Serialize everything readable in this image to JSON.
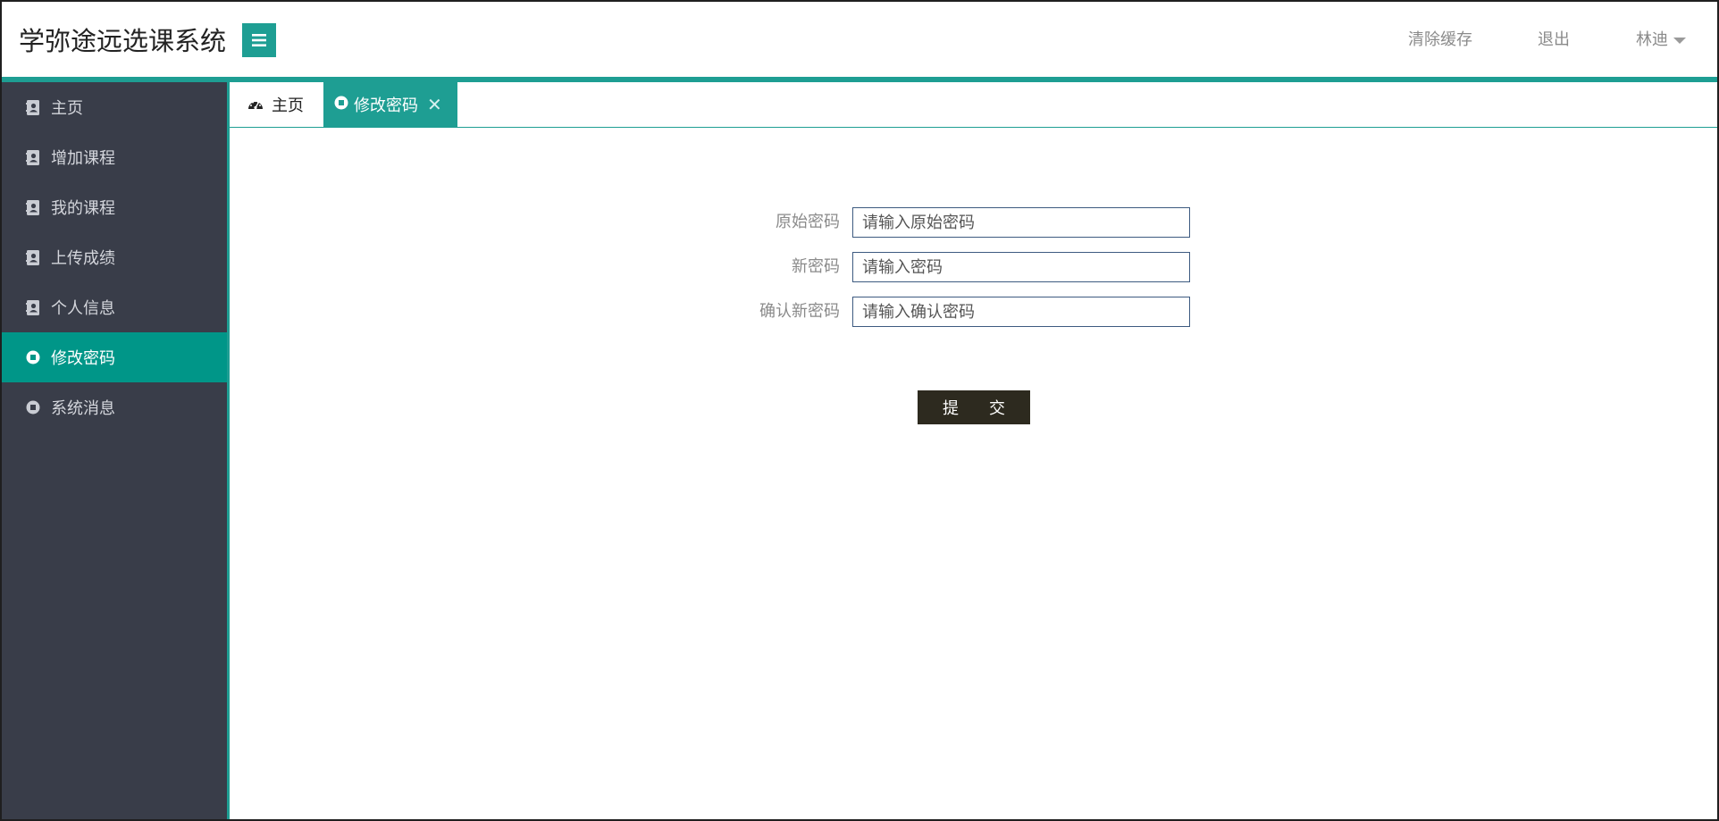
{
  "header": {
    "app_title": "学弥途远选课系统",
    "menu_toggle_icon": "hamburger-icon",
    "clear_cache": "清除缓存",
    "logout": "退出",
    "username": "林迪"
  },
  "sidebar": {
    "items": [
      {
        "label": "主页",
        "icon": "contact-book-icon",
        "active": false
      },
      {
        "label": "增加课程",
        "icon": "contact-book-icon",
        "active": false
      },
      {
        "label": "我的课程",
        "icon": "contact-book-icon",
        "active": false
      },
      {
        "label": "上传成绩",
        "icon": "contact-book-icon",
        "active": false
      },
      {
        "label": "个人信息",
        "icon": "contact-book-icon",
        "active": false
      },
      {
        "label": "修改密码",
        "icon": "circle-stop-icon",
        "active": true
      },
      {
        "label": "系统消息",
        "icon": "circle-stop-icon",
        "active": false
      }
    ]
  },
  "tabs": [
    {
      "label": "主页",
      "icon": "dashboard-icon",
      "active": false
    },
    {
      "label": "修改密码",
      "icon": "circle-stop-icon",
      "active": true,
      "closable": true
    }
  ],
  "form": {
    "original_password": {
      "label": "原始密码",
      "placeholder": "请输入原始密码",
      "value": ""
    },
    "new_password": {
      "label": "新密码",
      "placeholder": "请输入密码",
      "value": ""
    },
    "confirm_password": {
      "label": "确认新密码",
      "placeholder": "请输入确认密码",
      "value": ""
    },
    "submit": {
      "char1": "提",
      "char2": "交"
    }
  },
  "colors": {
    "accent": "#1e9e93",
    "sidebar_bg": "#393d49",
    "sidebar_active": "#009688",
    "submit_bg": "#2d2a1f"
  }
}
